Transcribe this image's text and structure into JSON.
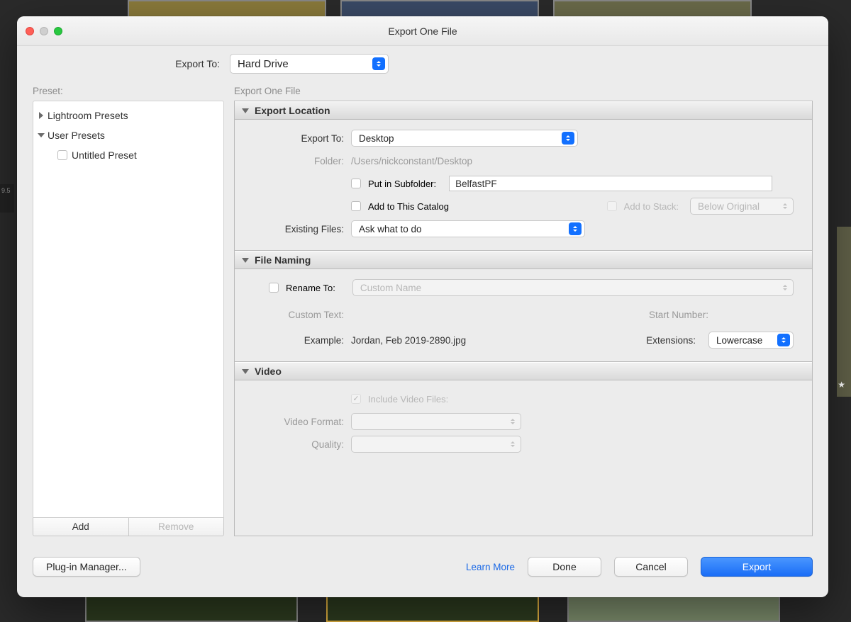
{
  "window": {
    "title": "Export One File"
  },
  "top": {
    "exportTo_label": "Export To:",
    "exportTo_value": "Hard Drive"
  },
  "presets": {
    "label": "Preset:",
    "groups": {
      "lightroom": "Lightroom Presets",
      "user": "User Presets",
      "untitled": "Untitled Preset"
    },
    "add": "Add",
    "remove": "Remove"
  },
  "rightLabel": "Export One File",
  "panels": {
    "exportLocation": {
      "title": "Export Location",
      "exportTo_label": "Export To:",
      "exportTo_value": "Desktop",
      "folder_label": "Folder:",
      "folder_value": "/Users/nickconstant/Desktop",
      "subfolder_label": "Put in Subfolder:",
      "subfolder_value": "BelfastPF",
      "addCatalog_label": "Add to This Catalog",
      "addStack_label": "Add to Stack:",
      "addStack_value": "Below Original",
      "existingFiles_label": "Existing Files:",
      "existingFiles_value": "Ask what to do"
    },
    "fileNaming": {
      "title": "File Naming",
      "renameTo_label": "Rename To:",
      "renameTo_value": "Custom Name",
      "customText_label": "Custom Text:",
      "startNumber_label": "Start Number:",
      "example_label": "Example:",
      "example_value": "Jordan, Feb 2019-2890.jpg",
      "extensions_label": "Extensions:",
      "extensions_value": "Lowercase"
    },
    "video": {
      "title": "Video",
      "include_label": "Include Video Files:",
      "videoFormat_label": "Video Format:",
      "quality_label": "Quality:"
    }
  },
  "footer": {
    "plugin": "Plug-in Manager...",
    "learn": "Learn More",
    "done": "Done",
    "cancel": "Cancel",
    "export": "Export"
  },
  "bg": {
    "leftText": "9.5"
  }
}
